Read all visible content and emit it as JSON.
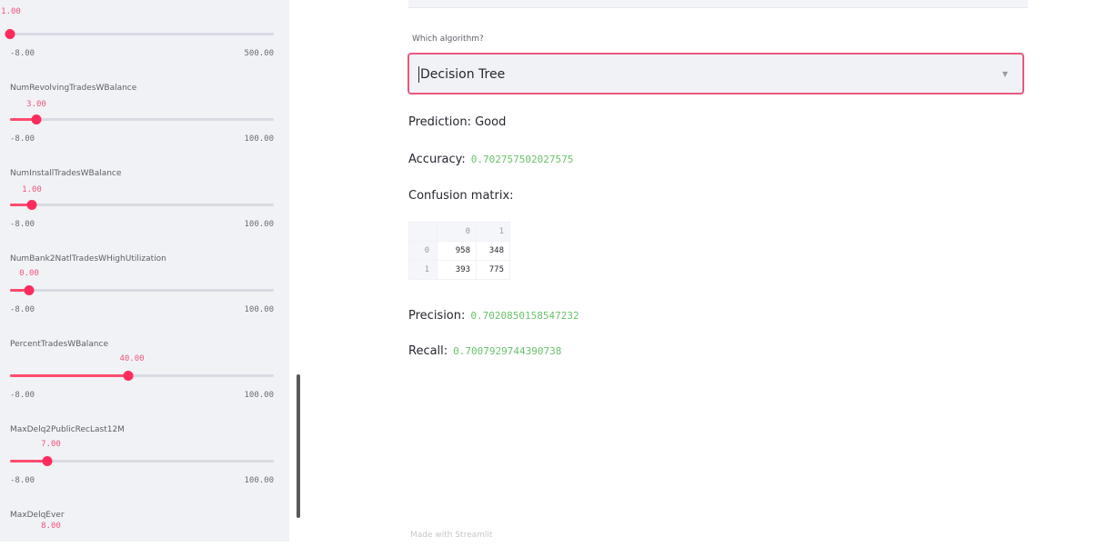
{
  "sidebar": {
    "sliders": [
      {
        "label": "",
        "value": "1.00",
        "value_fraction": 0.0,
        "min": "-8.00",
        "max": "500.00"
      },
      {
        "label": "NumRevolvingTradesWBalance",
        "value": "3.00",
        "value_fraction": 0.1,
        "min": "-8.00",
        "max": "100.00"
      },
      {
        "label": "NumInstallTradesWBalance",
        "value": "1.00",
        "value_fraction": 0.08,
        "min": "-8.00",
        "max": "100.00"
      },
      {
        "label": "NumBank2NatlTradesWHighUtilization",
        "value": "0.00",
        "value_fraction": 0.07,
        "min": "-8.00",
        "max": "100.00"
      },
      {
        "label": "PercentTradesWBalance",
        "value": "40.00",
        "value_fraction": 0.45,
        "min": "-8.00",
        "max": "100.00"
      },
      {
        "label": "MaxDelq2PublicRecLast12M",
        "value": "7.00",
        "value_fraction": 0.14,
        "min": "-8.00",
        "max": "100.00"
      },
      {
        "label": "MaxDelqEver",
        "value": "8.00",
        "value_fraction": null,
        "min": "",
        "max": ""
      }
    ]
  },
  "main": {
    "algorithm_label": "Which algorithm?",
    "algorithm_selected": "Decision Tree",
    "prediction": "Prediction: Good",
    "accuracy_label": "Accuracy:",
    "accuracy_value": "0.702757502027575",
    "confusion_label": "Confusion matrix:",
    "confusion_matrix": {
      "columns": [
        "0",
        "1"
      ],
      "rows": [
        {
          "index": "0",
          "values": [
            "958",
            "348"
          ]
        },
        {
          "index": "1",
          "values": [
            "393",
            "775"
          ]
        }
      ]
    },
    "precision_label": "Precision:",
    "precision_value": "0.7020850158547232",
    "recall_label": "Recall:",
    "recall_value": "0.7007929744390738",
    "footer": "Made with Streamlit"
  },
  "colors": {
    "accent": "#ff4b6e",
    "number_green": "#6ac26c",
    "sidebar_bg": "#f0f2f6"
  }
}
